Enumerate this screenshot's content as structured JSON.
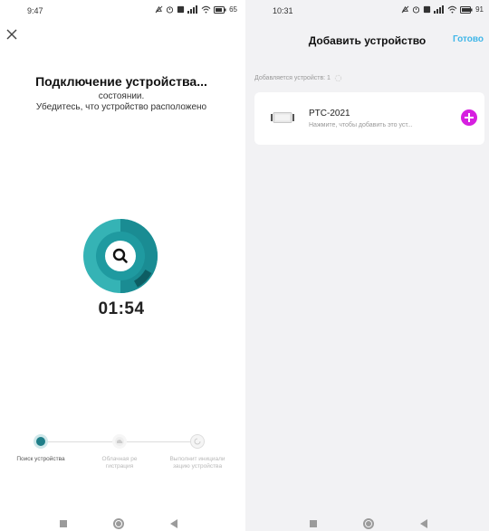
{
  "left_screen": {
    "status_time": "9:47",
    "battery": "65",
    "title": "Подключение устройства...",
    "subtitle_line1": "состоянии.",
    "subtitle_line2": "Убедитесь, что устройство расположено",
    "timer": "01:54",
    "steps": [
      {
        "label": "Поиск устройства",
        "state": "active"
      },
      {
        "label": "Облачная ре гистрация",
        "state": "pending"
      },
      {
        "label": "Выполнит инициали зацию устройства",
        "state": "pending"
      }
    ],
    "icons": {
      "close": "close-icon",
      "search": "search-icon"
    },
    "colors": {
      "teal": "#1a8c93",
      "teal_light": "#35b3b5",
      "teal_dark": "#0d5d63"
    }
  },
  "right_screen": {
    "status_time": "10:31",
    "battery": "91",
    "title": "Добавить устройство",
    "done_label": "Готово",
    "adding_text": "Добавляется устройств: 1",
    "device": {
      "name": "PTC-2021",
      "hint": "Нажмите, чтобы добавить это уст..."
    },
    "colors": {
      "accent": "#3fb6e8",
      "add": "#d61fe0"
    }
  }
}
